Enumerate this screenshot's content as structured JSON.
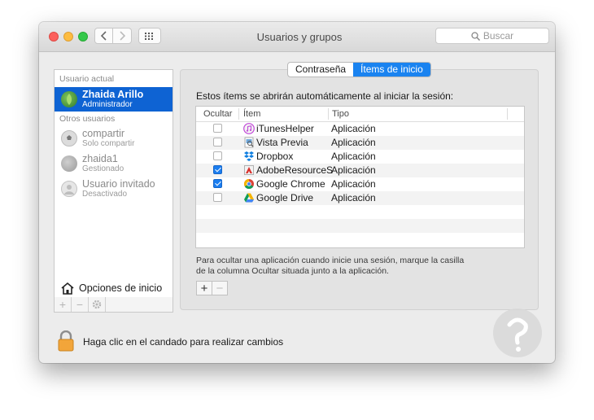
{
  "window": {
    "title": "Usuarios y grupos",
    "search_placeholder": "Buscar"
  },
  "sidebar": {
    "current_user_label": "Usuario actual",
    "current_user": {
      "name": "Zhaida Arillo",
      "role": "Administrador"
    },
    "other_users_label": "Otros usuarios",
    "other_users": [
      {
        "name": "compartir",
        "role": "Solo compartir"
      },
      {
        "name": "zhaida1",
        "role": "Gestionado"
      },
      {
        "name": "Usuario invitado",
        "role": "Desactivado"
      }
    ],
    "login_options_label": "Opciones de inicio",
    "buttons": {
      "add": "+",
      "remove": "−"
    }
  },
  "tabs": [
    {
      "label": "Contraseña",
      "active": false
    },
    {
      "label": "Ítems de inicio",
      "active": true
    }
  ],
  "main": {
    "instructions": "Estos ítems se abrirán automáticamente al iniciar la sesión:",
    "columns": {
      "hide": "Ocultar",
      "item": "Ítem",
      "type": "Tipo"
    },
    "items": [
      {
        "name": "iTunesHelper",
        "type": "Aplicación",
        "hidden": false,
        "icon": "itunes-icon"
      },
      {
        "name": "Vista Previa",
        "type": "Aplicación",
        "hidden": false,
        "icon": "preview-icon"
      },
      {
        "name": "Dropbox",
        "type": "Aplicación",
        "hidden": false,
        "icon": "dropbox-icon"
      },
      {
        "name": "AdobeResourceS",
        "type": "Aplicación",
        "hidden": true,
        "icon": "adobe-icon"
      },
      {
        "name": "Google Chrome",
        "type": "Aplicación",
        "hidden": true,
        "icon": "chrome-icon"
      },
      {
        "name": "Google Drive",
        "type": "Aplicación",
        "hidden": false,
        "icon": "drive-icon"
      }
    ],
    "help_line1": "Para ocultar una aplicación cuando inicie una sesión, marque la casilla",
    "help_line2": "de la columna Ocultar situada junto a la aplicación.",
    "add_label": "+",
    "remove_label": "−"
  },
  "footer": {
    "lock_text": "Haga clic en el candado para realizar cambios"
  },
  "colors": {
    "selection": "#0e63d3",
    "tab_active": "#1a83f0",
    "checkbox": "#1b7ef0"
  }
}
